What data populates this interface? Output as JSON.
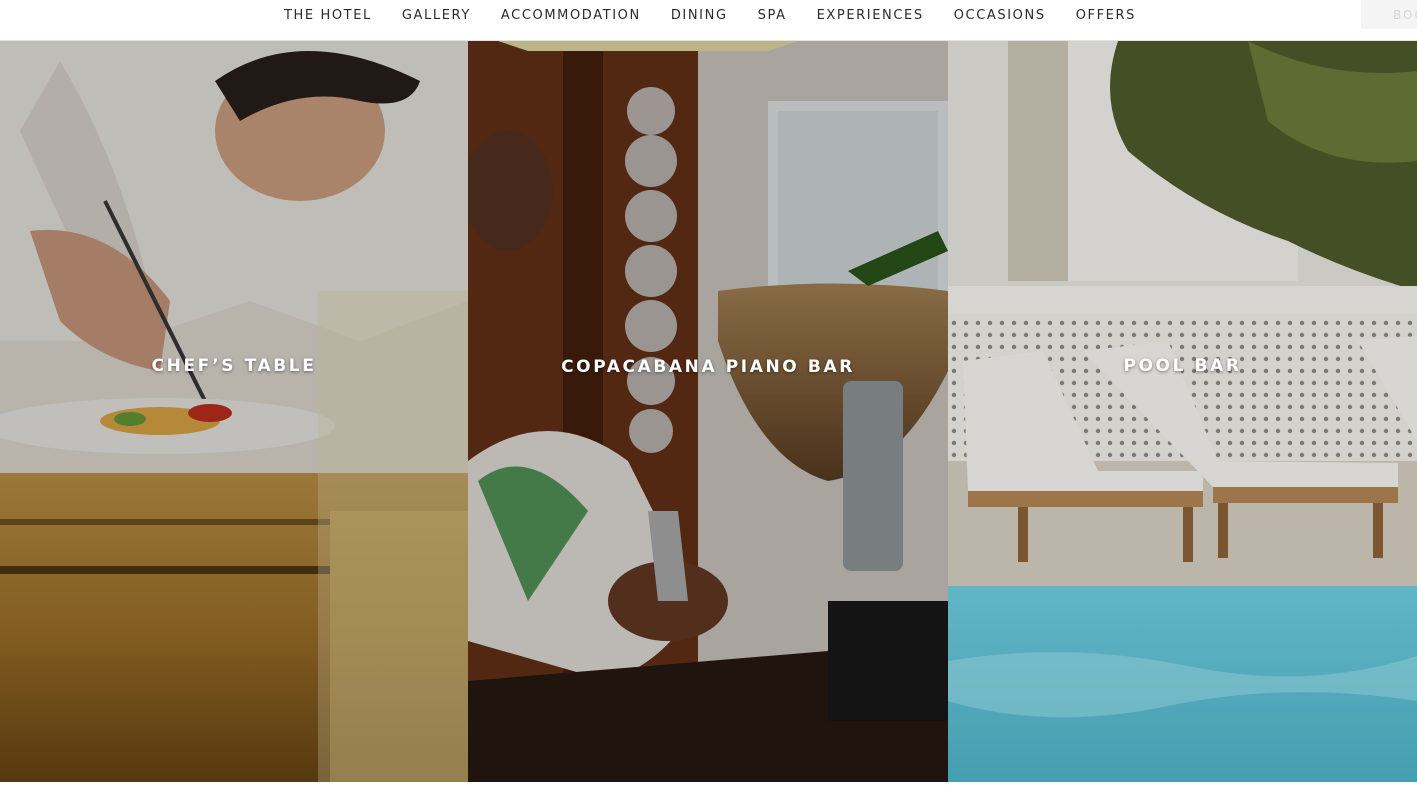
{
  "nav": {
    "items": [
      "THE HOTEL",
      "GALLERY",
      "ACCOMMODATION",
      "DINING",
      "SPA",
      "EXPERIENCES",
      "OCCASIONS",
      "OFFERS"
    ],
    "book_label": "BOOK"
  },
  "panels": [
    {
      "title": "CHEF’S TABLE",
      "image": "chef-plating-dish"
    },
    {
      "title": "COPACABANA PIANO BAR",
      "image": "bartender-mixing-cocktail"
    },
    {
      "title": "POOL BAR",
      "image": "poolside-loungers"
    }
  ],
  "colors": {
    "nav_bg": "#ffffff",
    "nav_text": "#2b2b2b",
    "title_text": "#ffffff",
    "pool": "#5cc3d6"
  }
}
